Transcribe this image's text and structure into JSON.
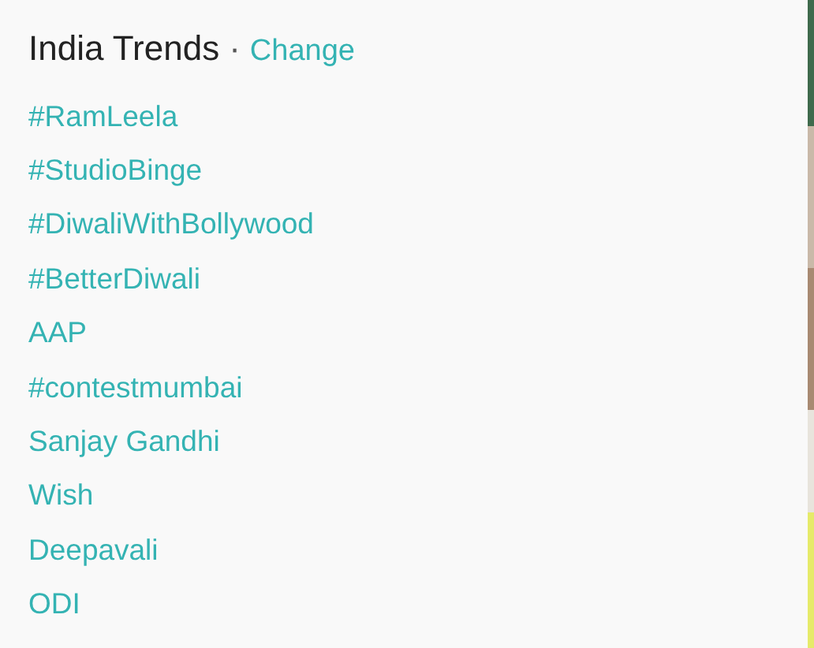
{
  "header": {
    "title": "India Trends",
    "separator": "·",
    "change_link": "Change"
  },
  "trends": [
    {
      "label": "#RamLeela"
    },
    {
      "label": "#StudioBinge"
    },
    {
      "label": "#DiwaliWithBollywood"
    },
    {
      "label": "#BetterDiwali"
    },
    {
      "label": "AAP"
    },
    {
      "label": "#contestmumbai"
    },
    {
      "label": "Sanjay Gandhi"
    },
    {
      "label": "Wish"
    },
    {
      "label": "Deepavali"
    },
    {
      "label": "ODI"
    }
  ]
}
